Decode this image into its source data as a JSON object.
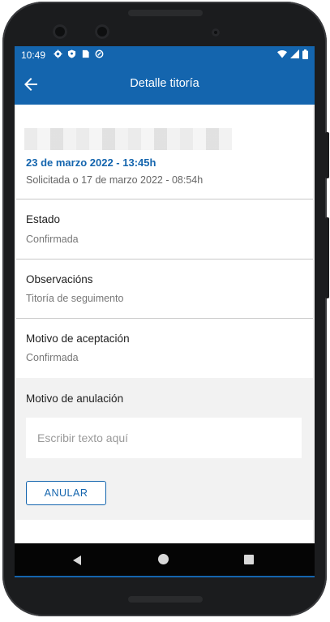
{
  "status_bar": {
    "time": "10:49",
    "left_icons": [
      "gear-icon",
      "shield-icon",
      "sim-icon",
      "sync-icon"
    ],
    "right_icons": [
      "wifi-icon",
      "signal-icon",
      "battery-icon"
    ]
  },
  "app_bar": {
    "title": "Detalle titoría",
    "back_icon": "arrow-left-icon",
    "color": "#1465ae"
  },
  "detail": {
    "date": "23 de marzo 2022 - 13:45h",
    "requested": "Solicitada o 17 de marzo 2022 - 08:54h",
    "fields": [
      {
        "label": "Estado",
        "value": "Confirmada"
      },
      {
        "label": "Observacións",
        "value": "Titoría de seguimento"
      },
      {
        "label": "Motivo de aceptación",
        "value": "Confirmada"
      }
    ]
  },
  "cancel": {
    "label": "Motivo de anulación",
    "placeholder": "Escribir texto aquí",
    "value": "",
    "button_label": "ANULAR"
  },
  "nav": {
    "icons": [
      "nav-back-icon",
      "nav-home-icon",
      "nav-recents-icon"
    ]
  }
}
